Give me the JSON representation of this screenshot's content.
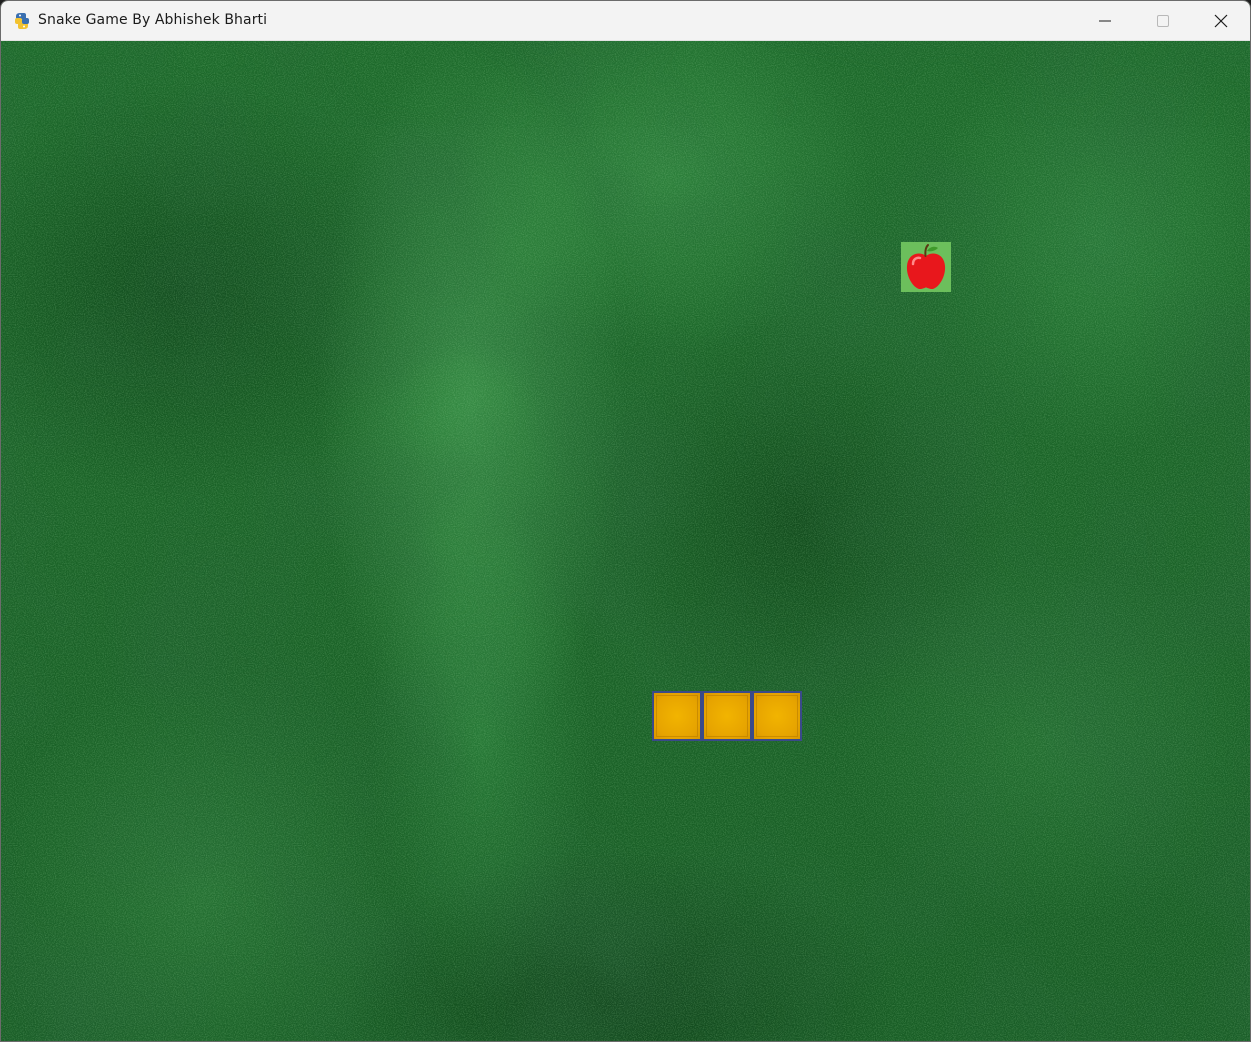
{
  "window": {
    "title": "Snake Game By Abhishek Bharti",
    "app_icon": "python-icon"
  },
  "caption_buttons": [
    {
      "name": "minimize-button",
      "icon": "minimize-icon"
    },
    {
      "name": "maximize-button",
      "icon": "maximize-icon",
      "state": "disabled"
    },
    {
      "name": "close-button",
      "icon": "close-icon"
    }
  ],
  "game": {
    "background": "green-textured-carpet",
    "food": {
      "icon": "apple-icon",
      "tile_color": "#6cbf5c",
      "apple_color": "#e8171c"
    },
    "snake": {
      "length": 3,
      "segment_color": "#e6a300",
      "border_color": "#3a4a8a"
    }
  },
  "colors": {
    "titlebar": "#f3f3f3",
    "title_text": "#1b1b1b",
    "field_green": "#1b6428"
  }
}
